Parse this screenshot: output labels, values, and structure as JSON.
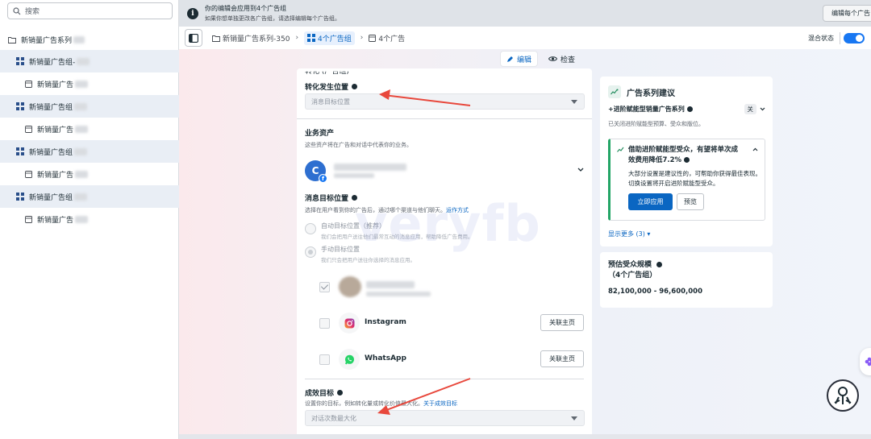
{
  "sidebar": {
    "search_placeholder": "搜索",
    "campaign": "新销量广告系列",
    "items": [
      {
        "type": "adset",
        "label": "新销量广告组-"
      },
      {
        "type": "ad",
        "label": "新销量广告"
      },
      {
        "type": "adset",
        "label": "新销量广告组"
      },
      {
        "type": "ad",
        "label": "新销量广告"
      },
      {
        "type": "adset",
        "label": "新销量广告组"
      },
      {
        "type": "ad",
        "label": "新销量广告"
      },
      {
        "type": "adset",
        "label": "新销量广告组"
      },
      {
        "type": "ad",
        "label": "新销量广告"
      }
    ]
  },
  "banner": {
    "line1": "你的编辑会应用到4个广告组",
    "line2": "如果你想单独更改各广告组，请选择编辑每个广告组。",
    "edit_each": "编辑每个广告"
  },
  "toolbar": {
    "crumb_campaign": "新销量广告系列-350",
    "crumb_adsets": "4个广告组",
    "crumb_ads": "4个广告",
    "mixed_status": "混合状态"
  },
  "modes": {
    "edit": "编辑",
    "review": "检查"
  },
  "form": {
    "cutoff_title": "转化 (广告组)",
    "conversion_location_label": "转化发生位置",
    "conversion_location_value": "消息目标位置",
    "business_assets_label": "业务资产",
    "business_assets_desc": "这些资产将在广告和对话中代表你的业务。",
    "page_avatar_letter": "C",
    "msg_destinations_label": "消息目标位置",
    "msg_destinations_desc": "选择在用户看到你的广告后，通过哪个渠道与他们聊天。",
    "msg_destinations_link": "运作方式",
    "auto_option": "自动目标位置（推荐）",
    "auto_option_desc": "我们会把用户送往他们最常互动的消息应用，帮助降低广告费用。",
    "manual_option": "手动目标位置",
    "manual_option_desc": "我们只会把用户送往你选择的消息应用。",
    "apps": [
      {
        "name": "Instagram",
        "button": "关联主页"
      },
      {
        "name": "WhatsApp",
        "button": "关联主页"
      }
    ],
    "goal_label": "成效目标",
    "goal_desc": "设置你的目标，例如转化量或转化价值最大化。",
    "goal_link": "关于成效目标",
    "goal_value": "对话次数最大化"
  },
  "watermark": "veryfb",
  "recommendations": {
    "title": "广告系列建议",
    "feature": "+进阶赋能型销量广告系列",
    "feature_state": "关",
    "feature_note": "已关闭进阶赋能型预算、受众和版位。",
    "suggestion_title": "借助进阶赋能型受众，有望将单次成效费用降低7.2%",
    "suggestion_body": "大部分设置是建议性的，可帮助你获得最佳表现。切换设置将开启进阶赋能型受众。",
    "apply": "立即应用",
    "preview": "预览",
    "show_more": "显示更多 (3)"
  },
  "audience": {
    "title": "预估受众规模",
    "subtitle": "（4个广告组）",
    "range": "82,100,000 - 96,600,000"
  },
  "colors": {
    "accent": "#0a66c2",
    "toggle": "#1877f2",
    "arrow": "#e8483c",
    "suggest_border": "#23a566"
  }
}
